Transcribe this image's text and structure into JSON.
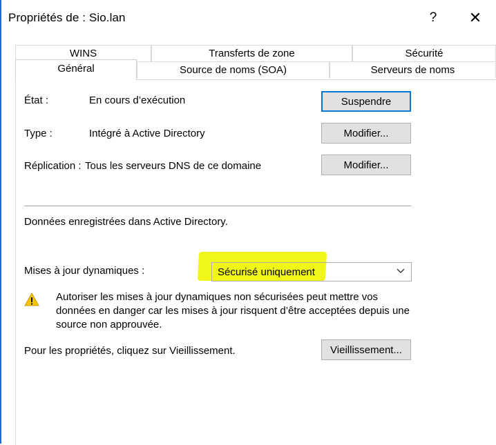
{
  "window": {
    "title": "Propriétés de : Sio.lan",
    "help": "?",
    "close": "✕"
  },
  "tabs": {
    "row1": [
      "WINS",
      "Transferts de zone",
      "Sécurité"
    ],
    "row2": [
      "Général",
      "Source de noms (SOA)",
      "Serveurs de noms"
    ],
    "active": "Général"
  },
  "general": {
    "state_label": "État :",
    "state_value": "En cours d’exécution",
    "suspend_button": "Suspendre",
    "type_label": "Type :",
    "type_value": "Intégré à Active Directory",
    "type_button": "Modifier...",
    "replication_label": "Réplication :",
    "replication_value": "Tous les serveurs DNS de ce domaine",
    "replication_button": "Modifier...",
    "ad_note": "Données enregistrées dans Active Directory.",
    "dynamic_updates_label": "Mises à jour dynamiques :",
    "dynamic_updates_value": "Sécurisé uniquement",
    "warning_text": "Autoriser les mises à jour dynamiques non sécurisées peut mettre vos données en danger car les mises à jour risquent d’être acceptées depuis une source non approuvée.",
    "aging_hint": "Pour les propriétés, cliquez sur Vieillissement.",
    "aging_button": "Vieillissement..."
  },
  "colors": {
    "accent": "#0078d7",
    "highlight": "#f0f500",
    "warning_fill": "#f5c400"
  },
  "icons": {
    "warning": "warning-triangle-icon",
    "dropdown": "chevron-down-icon"
  }
}
